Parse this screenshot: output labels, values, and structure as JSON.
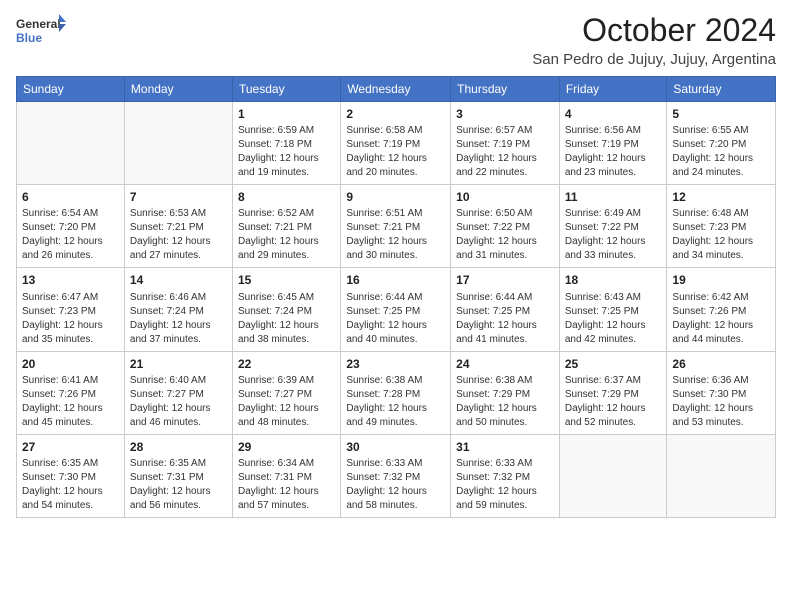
{
  "header": {
    "logo_line1": "General",
    "logo_line2": "Blue",
    "main_title": "October 2024",
    "subtitle": "San Pedro de Jujuy, Jujuy, Argentina"
  },
  "days_of_week": [
    "Sunday",
    "Monday",
    "Tuesday",
    "Wednesday",
    "Thursday",
    "Friday",
    "Saturday"
  ],
  "weeks": [
    [
      {
        "day": "",
        "info": ""
      },
      {
        "day": "",
        "info": ""
      },
      {
        "day": "1",
        "info": "Sunrise: 6:59 AM\nSunset: 7:18 PM\nDaylight: 12 hours and 19 minutes."
      },
      {
        "day": "2",
        "info": "Sunrise: 6:58 AM\nSunset: 7:19 PM\nDaylight: 12 hours and 20 minutes."
      },
      {
        "day": "3",
        "info": "Sunrise: 6:57 AM\nSunset: 7:19 PM\nDaylight: 12 hours and 22 minutes."
      },
      {
        "day": "4",
        "info": "Sunrise: 6:56 AM\nSunset: 7:19 PM\nDaylight: 12 hours and 23 minutes."
      },
      {
        "day": "5",
        "info": "Sunrise: 6:55 AM\nSunset: 7:20 PM\nDaylight: 12 hours and 24 minutes."
      }
    ],
    [
      {
        "day": "6",
        "info": "Sunrise: 6:54 AM\nSunset: 7:20 PM\nDaylight: 12 hours and 26 minutes."
      },
      {
        "day": "7",
        "info": "Sunrise: 6:53 AM\nSunset: 7:21 PM\nDaylight: 12 hours and 27 minutes."
      },
      {
        "day": "8",
        "info": "Sunrise: 6:52 AM\nSunset: 7:21 PM\nDaylight: 12 hours and 29 minutes."
      },
      {
        "day": "9",
        "info": "Sunrise: 6:51 AM\nSunset: 7:21 PM\nDaylight: 12 hours and 30 minutes."
      },
      {
        "day": "10",
        "info": "Sunrise: 6:50 AM\nSunset: 7:22 PM\nDaylight: 12 hours and 31 minutes."
      },
      {
        "day": "11",
        "info": "Sunrise: 6:49 AM\nSunset: 7:22 PM\nDaylight: 12 hours and 33 minutes."
      },
      {
        "day": "12",
        "info": "Sunrise: 6:48 AM\nSunset: 7:23 PM\nDaylight: 12 hours and 34 minutes."
      }
    ],
    [
      {
        "day": "13",
        "info": "Sunrise: 6:47 AM\nSunset: 7:23 PM\nDaylight: 12 hours and 35 minutes."
      },
      {
        "day": "14",
        "info": "Sunrise: 6:46 AM\nSunset: 7:24 PM\nDaylight: 12 hours and 37 minutes."
      },
      {
        "day": "15",
        "info": "Sunrise: 6:45 AM\nSunset: 7:24 PM\nDaylight: 12 hours and 38 minutes."
      },
      {
        "day": "16",
        "info": "Sunrise: 6:44 AM\nSunset: 7:25 PM\nDaylight: 12 hours and 40 minutes."
      },
      {
        "day": "17",
        "info": "Sunrise: 6:44 AM\nSunset: 7:25 PM\nDaylight: 12 hours and 41 minutes."
      },
      {
        "day": "18",
        "info": "Sunrise: 6:43 AM\nSunset: 7:25 PM\nDaylight: 12 hours and 42 minutes."
      },
      {
        "day": "19",
        "info": "Sunrise: 6:42 AM\nSunset: 7:26 PM\nDaylight: 12 hours and 44 minutes."
      }
    ],
    [
      {
        "day": "20",
        "info": "Sunrise: 6:41 AM\nSunset: 7:26 PM\nDaylight: 12 hours and 45 minutes."
      },
      {
        "day": "21",
        "info": "Sunrise: 6:40 AM\nSunset: 7:27 PM\nDaylight: 12 hours and 46 minutes."
      },
      {
        "day": "22",
        "info": "Sunrise: 6:39 AM\nSunset: 7:27 PM\nDaylight: 12 hours and 48 minutes."
      },
      {
        "day": "23",
        "info": "Sunrise: 6:38 AM\nSunset: 7:28 PM\nDaylight: 12 hours and 49 minutes."
      },
      {
        "day": "24",
        "info": "Sunrise: 6:38 AM\nSunset: 7:29 PM\nDaylight: 12 hours and 50 minutes."
      },
      {
        "day": "25",
        "info": "Sunrise: 6:37 AM\nSunset: 7:29 PM\nDaylight: 12 hours and 52 minutes."
      },
      {
        "day": "26",
        "info": "Sunrise: 6:36 AM\nSunset: 7:30 PM\nDaylight: 12 hours and 53 minutes."
      }
    ],
    [
      {
        "day": "27",
        "info": "Sunrise: 6:35 AM\nSunset: 7:30 PM\nDaylight: 12 hours and 54 minutes."
      },
      {
        "day": "28",
        "info": "Sunrise: 6:35 AM\nSunset: 7:31 PM\nDaylight: 12 hours and 56 minutes."
      },
      {
        "day": "29",
        "info": "Sunrise: 6:34 AM\nSunset: 7:31 PM\nDaylight: 12 hours and 57 minutes."
      },
      {
        "day": "30",
        "info": "Sunrise: 6:33 AM\nSunset: 7:32 PM\nDaylight: 12 hours and 58 minutes."
      },
      {
        "day": "31",
        "info": "Sunrise: 6:33 AM\nSunset: 7:32 PM\nDaylight: 12 hours and 59 minutes."
      },
      {
        "day": "",
        "info": ""
      },
      {
        "day": "",
        "info": ""
      }
    ]
  ]
}
